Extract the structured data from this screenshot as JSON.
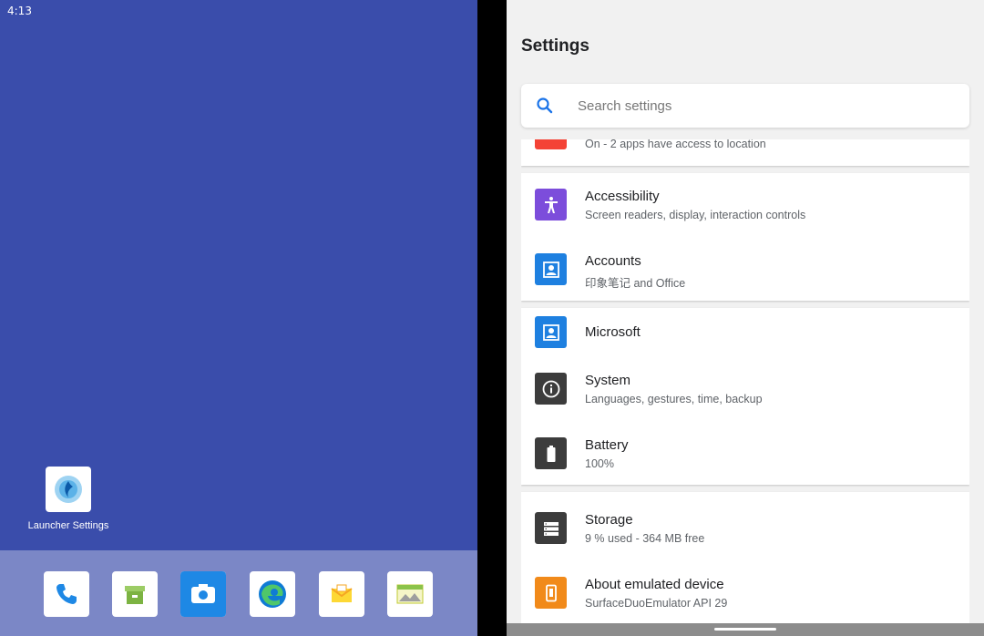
{
  "status_bar": {
    "time": "4:13"
  },
  "home": {
    "launcher_app": {
      "label": "Launcher Settings",
      "icon": "launcher-settings-icon"
    },
    "dock": [
      {
        "name": "phone",
        "icon": "phone-icon",
        "color": "#1e88e5"
      },
      {
        "name": "store",
        "icon": "store-icon",
        "color": "#7cb342"
      },
      {
        "name": "camera",
        "icon": "camera-icon",
        "color": "#1e88e5"
      },
      {
        "name": "edge",
        "icon": "edge-icon",
        "color": "#0f7bd4"
      },
      {
        "name": "email",
        "icon": "email-icon",
        "color": "#f5a623"
      },
      {
        "name": "gallery",
        "icon": "gallery-icon",
        "color": "#8bc34a"
      }
    ]
  },
  "settings": {
    "title": "Settings",
    "search_placeholder": "Search settings",
    "location_item": {
      "subtitle": "On - 2 apps have access to location",
      "color": "#f44336"
    },
    "items": [
      {
        "title": "Accessibility",
        "subtitle": "Screen readers, display, interaction controls",
        "icon": "accessibility-icon",
        "color": "#7c4ddb"
      },
      {
        "title": "Accounts",
        "subtitle": "印象笔记 and Office",
        "icon": "account-icon",
        "color": "#1e80e0"
      },
      {
        "title": "Microsoft",
        "subtitle": "",
        "icon": "account-icon",
        "color": "#1e80e0"
      },
      {
        "title": "System",
        "subtitle": "Languages, gestures, time, backup",
        "icon": "info-icon",
        "color": "#3c3c3c"
      },
      {
        "title": "Battery",
        "subtitle": "100%",
        "icon": "battery-icon",
        "color": "#3c3c3c"
      },
      {
        "title": "Storage",
        "subtitle": "9 % used - 364 MB free",
        "icon": "storage-icon",
        "color": "#3c3c3c"
      },
      {
        "title": "About emulated device",
        "subtitle": "SurfaceDuoEmulator API 29",
        "icon": "device-icon",
        "color": "#f18a1a"
      }
    ]
  },
  "colors": {
    "wallpaper": "#3a4dab",
    "dock": "#7b87c6",
    "accent": "#1a73e8"
  }
}
